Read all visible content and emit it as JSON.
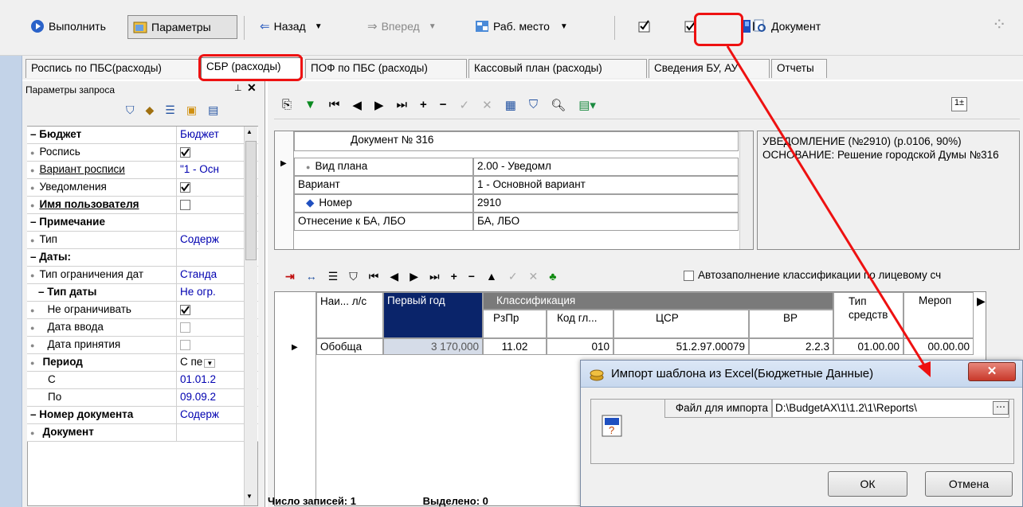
{
  "toolbar": {
    "run_label": "Выполнить",
    "params_label": "Параметры",
    "back_label": "Назад",
    "forward_label": "Вперед",
    "workplace_label": "Раб. место",
    "document_label": "Документ"
  },
  "tabs": [
    {
      "label": "Роспись по ПБС(расходы)"
    },
    {
      "label": "СБР (расходы)"
    },
    {
      "label": "ПОФ по ПБС (расходы)"
    },
    {
      "label": "Кассовый план (расходы)"
    },
    {
      "label": "Сведения БУ, АУ"
    },
    {
      "label": "Отчеты"
    }
  ],
  "left_panel": {
    "title": "Параметры запроса",
    "rows": [
      {
        "label": "– Бюджет",
        "value": "Бюджет"
      },
      {
        "label": "Роспись",
        "value": ""
      },
      {
        "label": "Вариант росписи",
        "value": "\"1 - Осн"
      },
      {
        "label": "Уведомления",
        "value": ""
      },
      {
        "label": "Имя пользователя",
        "value": ""
      },
      {
        "label": "– Примечание",
        "value": ""
      },
      {
        "label": "Тип",
        "value": "Содерж"
      },
      {
        "label": "– Даты:",
        "value": ""
      },
      {
        "label": "Тип ограничения дат",
        "value": "Станда"
      },
      {
        "label": "– Тип даты",
        "value": "Не огр."
      },
      {
        "label": "Не ограничивать",
        "value": ""
      },
      {
        "label": "Дата ввода",
        "value": ""
      },
      {
        "label": "Дата принятия",
        "value": ""
      },
      {
        "label": "Период",
        "value": "С пе"
      },
      {
        "label": "С",
        "value": "01.01.2"
      },
      {
        "label": "По",
        "value": "09.09.2"
      },
      {
        "label": "– Номер документа",
        "value": "Содерж"
      },
      {
        "label": "Документ",
        "value": ""
      }
    ]
  },
  "doc_grid": {
    "header": "Документ № 316",
    "rows": [
      {
        "label": "Вид плана",
        "value": "2.00 - Уведомл"
      },
      {
        "label": "Вариант",
        "value": "1 - Основной вариант"
      },
      {
        "label": "Номер",
        "value": "2910"
      },
      {
        "label": "Отнесение к БА, ЛБО",
        "value": "БА, ЛБО"
      }
    ],
    "note": "УВЕДОМЛЕНИЕ (№2910) (р.0106, 90%) ОСНОВАНИЕ: Решение городской Думы №316"
  },
  "autofill_label": "Автозаполнение классификации по лицевому сч",
  "data_grid": {
    "headers": {
      "name": "Наи... л/с",
      "first_year": "Первый год",
      "classification": "Классификация",
      "rzpr": "РзПр",
      "kod": "Код гл...",
      "csr": "ЦСР",
      "vr": "ВР",
      "type": "Тип средств",
      "event": "Мероп"
    },
    "row": {
      "name": "Обобща",
      "first_year": "3 170,000",
      "rzpr": "11.02",
      "kod": "010",
      "csr": "51.2.97.00079",
      "vr": "2.2.3",
      "type": "01.00.00",
      "event": "00.00.00"
    }
  },
  "status": {
    "records_label": "Число записей:",
    "records": "1",
    "selected_label": "Выделено:",
    "selected": "0"
  },
  "dialog": {
    "title": "Импорт шаблона из Excel(Бюджетные Данные)",
    "file_label": "Файл для импорта",
    "file_value": "D:\\BudgetAX\\1\\1.2\\1\\Reports\\",
    "ok_label": "ОК",
    "cancel_label": "Отмена"
  },
  "colors": {
    "highlight_red": "#ee1111",
    "selected_cell": "#0a246a",
    "link_blue": "#0000b0"
  }
}
